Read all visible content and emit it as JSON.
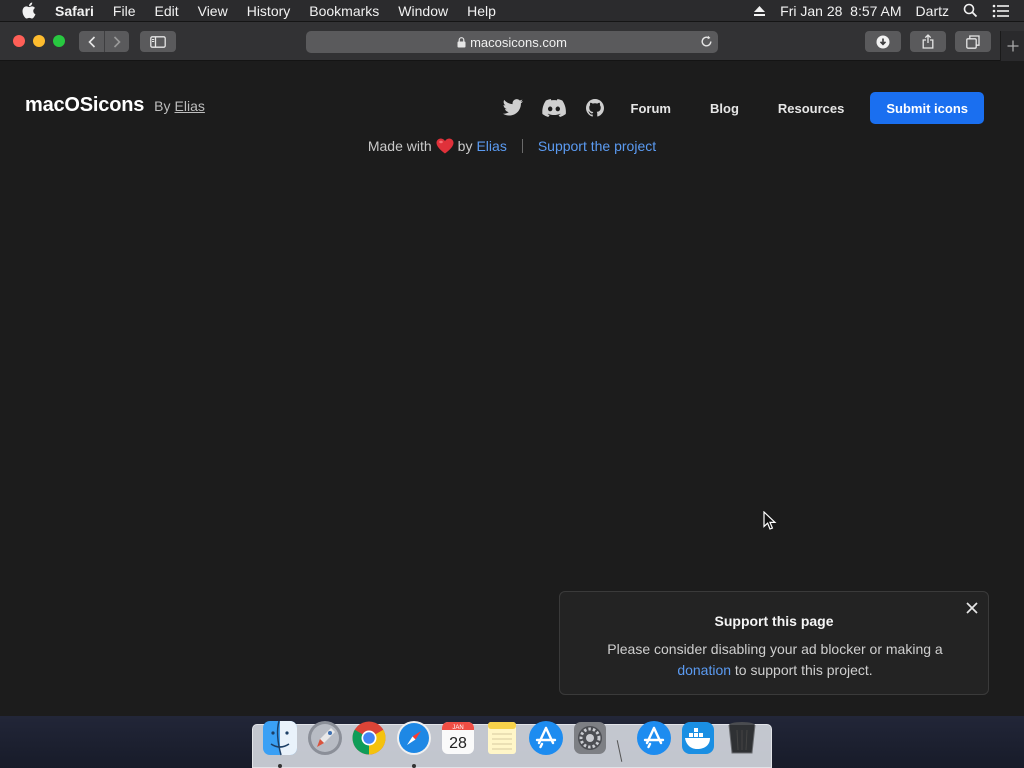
{
  "menubar": {
    "app": "Safari",
    "items": [
      "File",
      "Edit",
      "View",
      "History",
      "Bookmarks",
      "Window",
      "Help"
    ],
    "datetime": "Fri Jan 28  8:57 AM",
    "user": "Dartz"
  },
  "browser": {
    "url": "macosicons.com"
  },
  "site": {
    "logo": "macOSicons",
    "by": "By",
    "author": "Elias",
    "nav_links": [
      "Forum",
      "Blog",
      "Resources"
    ],
    "submit": "Submit icons",
    "tagline": {
      "made_with": "Made with",
      "by": "by",
      "author": "Elias",
      "support": "Support the project"
    }
  },
  "popup": {
    "title": "Support this page",
    "body_before": "Please consider disabling your ad blocker or making a",
    "link": "donation",
    "body_after": "to support this project."
  },
  "dock": {
    "calendar_month": "JAN",
    "calendar_day": "28",
    "apps": [
      "finder-icon",
      "launchpad-icon",
      "chrome-icon",
      "safari-icon",
      "calendar-icon",
      "notes-icon",
      "app-store-icon",
      "system-preferences-icon",
      "app-store-alt-icon",
      "docker-icon",
      "trash-icon"
    ]
  },
  "colors": {
    "accent": "#1a6ff0",
    "link": "#5b9bf2",
    "page_bg": "#1c1c1c"
  }
}
